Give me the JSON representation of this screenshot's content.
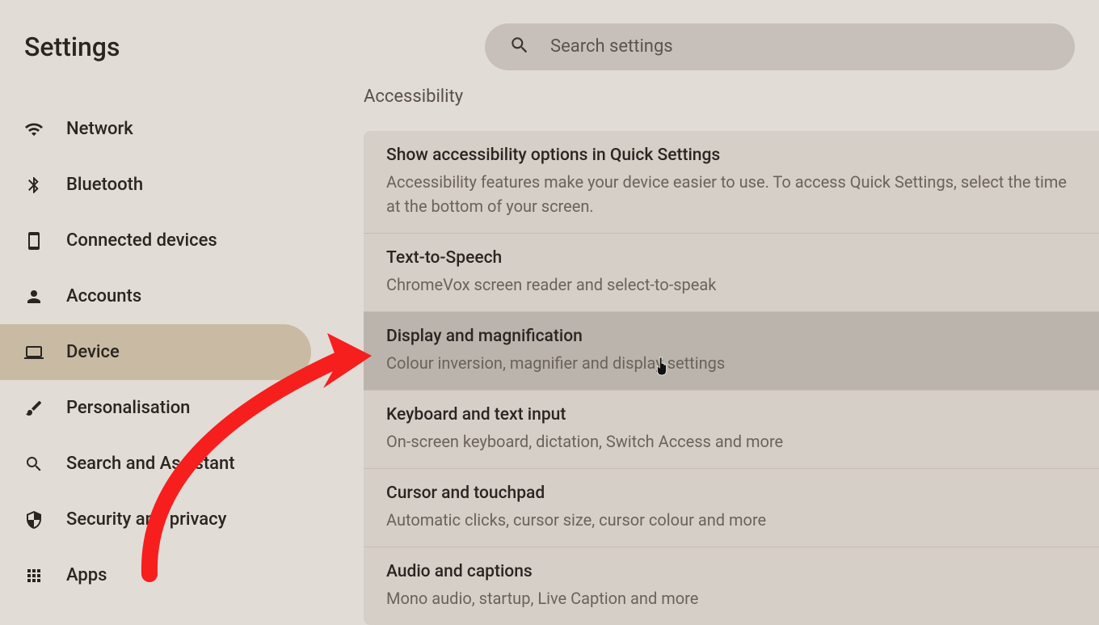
{
  "header": {
    "title": "Settings",
    "search_placeholder": "Search settings"
  },
  "sidebar": {
    "items": [
      {
        "label": "Network",
        "icon": "wifi"
      },
      {
        "label": "Bluetooth",
        "icon": "bluetooth"
      },
      {
        "label": "Connected devices",
        "icon": "phone"
      },
      {
        "label": "Accounts",
        "icon": "person"
      },
      {
        "label": "Device",
        "icon": "laptop",
        "selected": true
      },
      {
        "label": "Personalisation",
        "icon": "brush"
      },
      {
        "label": "Search and Assistant",
        "icon": "search"
      },
      {
        "label": "Security and privacy",
        "icon": "shield"
      },
      {
        "label": "Apps",
        "icon": "apps"
      }
    ]
  },
  "main": {
    "section_title": "Accessibility",
    "rows": [
      {
        "title": "Show accessibility options in Quick Settings",
        "desc": "Accessibility features make your device easier to use. To access Quick Settings, select the time at the bottom of your screen."
      },
      {
        "title": "Text-to-Speech",
        "desc": "ChromeVox screen reader and select-to-speak"
      },
      {
        "title": "Display and magnification",
        "desc": "Colour inversion, magnifier and display settings",
        "highlighted": true
      },
      {
        "title": "Keyboard and text input",
        "desc": "On-screen keyboard, dictation, Switch Access and more"
      },
      {
        "title": "Cursor and touchpad",
        "desc": "Automatic clicks, cursor size, cursor colour and more"
      },
      {
        "title": "Audio and captions",
        "desc": "Mono audio, startup, Live Caption and more"
      }
    ]
  },
  "annotation": {
    "arrow_color": "#f71e1e"
  }
}
